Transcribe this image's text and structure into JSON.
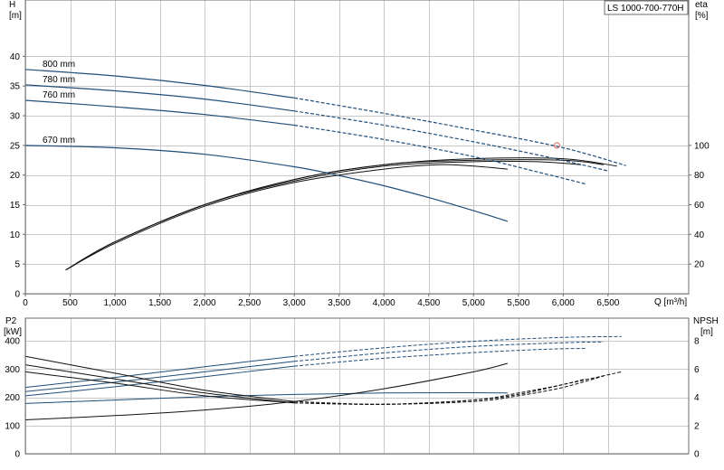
{
  "model": "LS 1000-700-770H",
  "colors": {
    "head": "#1f4e7a",
    "efficiency": "#111111",
    "grid": "#c8c8c8",
    "marker": "#e06060"
  },
  "chart_data": [
    {
      "type": "line",
      "title": "",
      "xlabel": "Q [m³/h]",
      "xlim": [
        0,
        7400
      ],
      "xticks": [
        0,
        500,
        1000,
        1500,
        2000,
        2500,
        3000,
        3500,
        4000,
        4500,
        5000,
        5500,
        6000,
        6500
      ],
      "xtick_labels": [
        "0",
        "500",
        "1,000",
        "1,500",
        "2,000",
        "2,500",
        "3,000",
        "3,500",
        "4,000",
        "4,500",
        "5,000",
        "5,500",
        "6,000",
        "6,500"
      ],
      "ylabel": "H\n[m]",
      "ylabel_lines": [
        "H",
        "[m]"
      ],
      "ylim": [
        0,
        49.5
      ],
      "yticks": [
        0,
        5,
        10,
        15,
        20,
        25,
        30,
        35,
        40
      ],
      "y2label_lines": [
        "eta",
        "[%]"
      ],
      "y2lim": [
        0,
        198
      ],
      "y2ticks": [
        20,
        40,
        60,
        80,
        100
      ],
      "grid": true,
      "head_curves": [
        {
          "name": "800 mm",
          "x": [
            0,
            1000,
            2000,
            3000,
            4000,
            5000,
            6000,
            6700
          ],
          "y": [
            37.8,
            36.7,
            35.1,
            33.0,
            30.4,
            27.6,
            24.6,
            21.6
          ],
          "solid_until": 3000
        },
        {
          "name": "780 mm",
          "x": [
            0,
            1000,
            2000,
            3000,
            4000,
            5000,
            5900,
            6500
          ],
          "y": [
            35.2,
            34.2,
            32.8,
            30.8,
            28.4,
            25.6,
            22.8,
            20.7
          ],
          "solid_until": 3000
        },
        {
          "name": "760 mm",
          "x": [
            0,
            1000,
            2000,
            3000,
            4000,
            5000,
            5800,
            6250
          ],
          "y": [
            32.6,
            31.5,
            30.2,
            28.4,
            26.0,
            23.1,
            20.2,
            18.5
          ],
          "solid_until": 3000
        },
        {
          "name": "670 mm",
          "x": [
            0,
            1000,
            2000,
            3000,
            3500,
            4000,
            4500,
            5000,
            5380
          ],
          "y": [
            25.0,
            24.6,
            23.5,
            21.4,
            19.9,
            18.2,
            16.2,
            14.0,
            12.2
          ],
          "solid_until": 5380
        }
      ],
      "efficiency_curves": [
        {
          "x": [
            450,
            1000,
            2000,
            3000,
            4000,
            5000,
            6000,
            6600
          ],
          "y": [
            16,
            35,
            60,
            77,
            87,
            91,
            91,
            86
          ]
        },
        {
          "x": [
            450,
            1000,
            2000,
            3000,
            4000,
            5000,
            6000,
            6450
          ],
          "y": [
            16,
            35,
            60,
            77,
            87,
            90,
            90,
            87
          ]
        },
        {
          "x": [
            450,
            1000,
            2000,
            3000,
            4000,
            5000,
            5700,
            6200
          ],
          "y": [
            16,
            35,
            60,
            76,
            86,
            89,
            89,
            87
          ]
        },
        {
          "x": [
            450,
            1000,
            2000,
            3000,
            4000,
            4600,
            5000,
            5380
          ],
          "y": [
            16,
            34,
            59,
            75,
            84,
            87,
            86,
            84
          ]
        }
      ],
      "duty_point": {
        "x": 5930,
        "y": 25.0
      }
    },
    {
      "type": "line",
      "title": "",
      "xlim": [
        0,
        7400
      ],
      "ylabel_lines": [
        "P2",
        "[kW]"
      ],
      "ylim": [
        0,
        480
      ],
      "yticks": [
        0,
        100,
        200,
        300,
        400
      ],
      "y2label_lines": [
        "NPSH",
        "[m]"
      ],
      "y2lim": [
        0,
        9.6
      ],
      "y2ticks": [
        0,
        2,
        4,
        6,
        8
      ],
      "grid": true,
      "power_curves": [
        {
          "name": "800 mm",
          "x": [
            0,
            1000,
            2000,
            3000,
            4000,
            5000,
            6000,
            6650
          ],
          "y": [
            235,
            270,
            308,
            345,
            375,
            398,
            412,
            415
          ],
          "solid_until": 3000
        },
        {
          "name": "780 mm",
          "x": [
            0,
            1000,
            2000,
            3000,
            4000,
            5000,
            6000,
            6450
          ],
          "y": [
            220,
            253,
            290,
            327,
            357,
            380,
            393,
            396
          ],
          "solid_until": 3000
        },
        {
          "name": "760 mm",
          "x": [
            0,
            1000,
            2000,
            3000,
            4000,
            5000,
            5800,
            6250
          ],
          "y": [
            205,
            237,
            273,
            310,
            338,
            358,
            370,
            373
          ],
          "solid_until": 3000
        },
        {
          "name": "670 mm",
          "x": [
            0,
            1000,
            2000,
            3000,
            4000,
            5000,
            5380
          ],
          "y": [
            178,
            190,
            202,
            210,
            215,
            216,
            215
          ],
          "solid_until": 5380
        }
      ],
      "npsh_curves": [
        {
          "x": [
            0,
            1000,
            2000,
            3000,
            4000,
            5000,
            5500,
            6000,
            6650
          ],
          "y": [
            6.9,
            5.7,
            4.5,
            3.7,
            3.5,
            3.8,
            4.3,
            4.9,
            5.8
          ],
          "solid_until": 3000
        },
        {
          "x": [
            0,
            1000,
            2000,
            3000,
            4000,
            5000,
            5500,
            6000,
            6450
          ],
          "y": [
            6.3,
            5.3,
            4.3,
            3.6,
            3.5,
            3.7,
            4.1,
            4.7,
            5.5
          ],
          "solid_until": 3000
        },
        {
          "x": [
            0,
            1000,
            2000,
            3000,
            4000,
            5000,
            5500,
            6000,
            6250
          ],
          "y": [
            5.8,
            5.0,
            4.1,
            3.6,
            3.5,
            3.8,
            4.2,
            4.9,
            5.3
          ],
          "solid_until": 3000
        },
        {
          "x": [
            0,
            1000,
            2000,
            3000,
            4000,
            5000,
            5380
          ],
          "y": [
            2.4,
            2.7,
            3.1,
            3.7,
            4.6,
            5.8,
            6.4
          ],
          "solid_until": 5380
        }
      ]
    }
  ]
}
